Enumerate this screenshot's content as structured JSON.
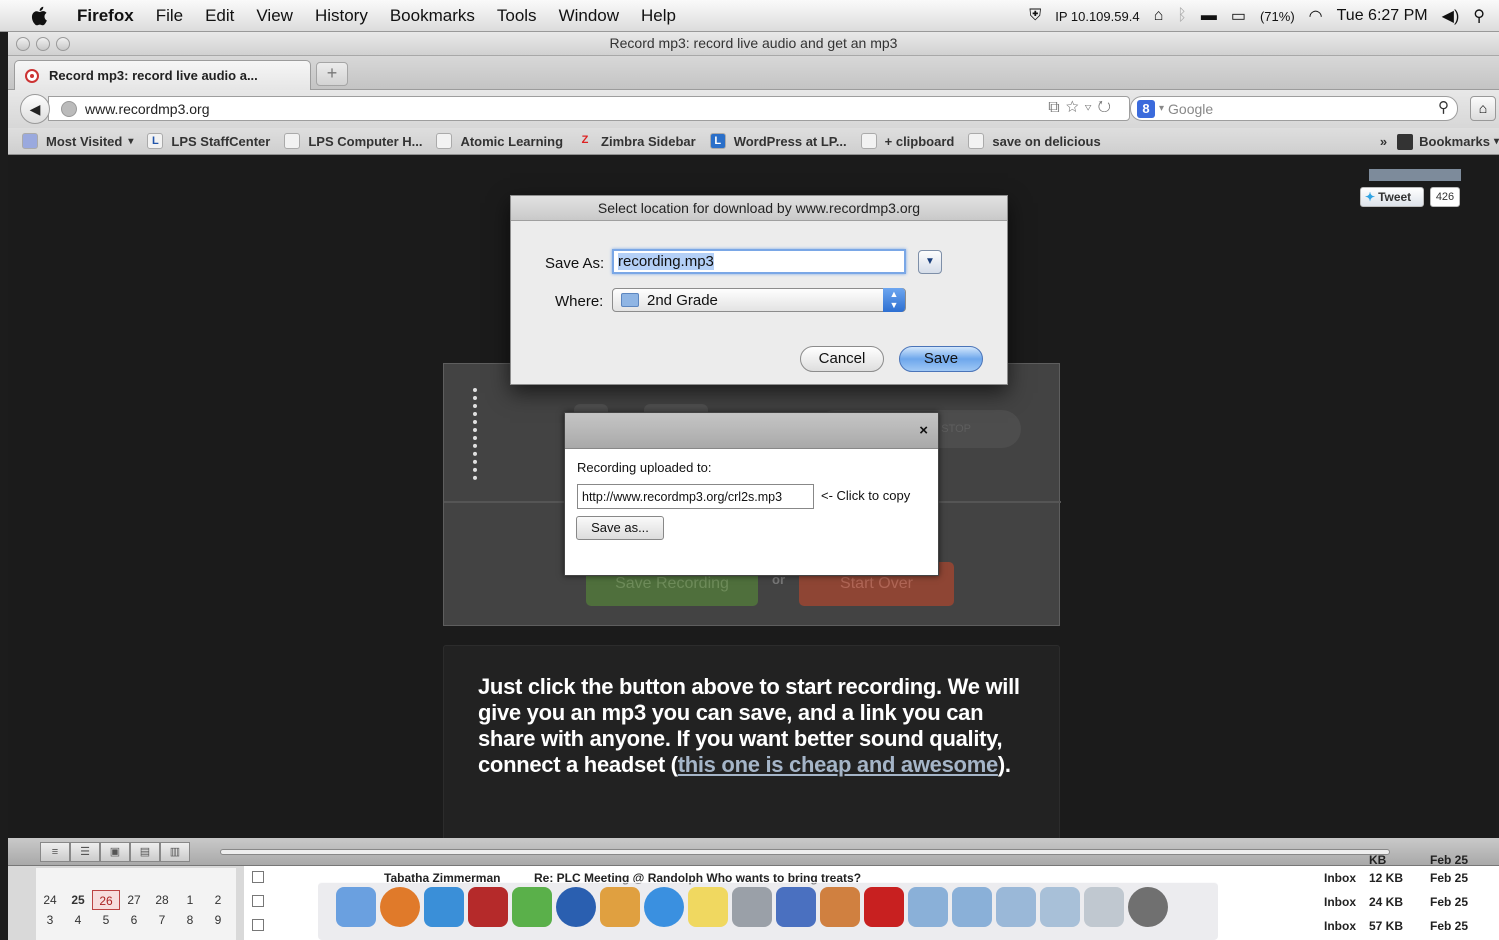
{
  "menubar": {
    "app_name": "Firefox",
    "items": [
      "File",
      "Edit",
      "View",
      "History",
      "Bookmarks",
      "Tools",
      "Window",
      "Help"
    ],
    "ip": "IP 10.109.59.4",
    "battery": "(71%)",
    "clock": "Tue 6:27 PM"
  },
  "window": {
    "title": "Record mp3: record live audio and get an mp3"
  },
  "tab": {
    "label": "Record mp3: record live audio a...",
    "new_tab": "+"
  },
  "navbar": {
    "url": "www.recordmp3.org",
    "search_placeholder": "Google"
  },
  "bookmarks": {
    "items": [
      "Most Visited",
      "LPS StaffCenter",
      "LPS Computer H...",
      "Atomic Learning",
      "Zimbra Sidebar",
      "WordPress at LP...",
      "+ clipboard",
      "save on delicious"
    ],
    "overflow": "»",
    "menu": "Bookmarks"
  },
  "tweet": {
    "label": "Tweet",
    "count": "426"
  },
  "recorder": {
    "save_recording": "Save Recording",
    "or": "or",
    "start_over": "Start Over",
    "stop": "STOP"
  },
  "info": {
    "text": "Just click the button above to start recording. We will give you an mp3 you can save, and a link you can share with anyone. If you want better sound quality, connect a headset (",
    "link": "this one is cheap and awesome",
    "after": ")."
  },
  "upload_popup": {
    "close": "×",
    "label": "Recording uploaded to:",
    "url": "http://www.recordmp3.org/crl2s.mp3",
    "copy_hint": "<- Click to copy",
    "save_as": "Save as..."
  },
  "save_dialog": {
    "title": "Select location for download by www.recordmp3.org",
    "save_as_label": "Save As:",
    "filename": "recording.mp3",
    "where_label": "Where:",
    "where_value": "2nd Grade",
    "cancel": "Cancel",
    "save": "Save"
  },
  "mail": {
    "calendar": [
      [
        "24",
        "25",
        "26",
        "27",
        "28",
        "1",
        "2"
      ],
      [
        "3",
        "4",
        "5",
        "6",
        "7",
        "8",
        "9"
      ]
    ],
    "today": "26",
    "rows": [
      {
        "sender": "Tabatha Zimmerman",
        "subject": "Re: PLC Meeting @ Randolph Who wants to bring treats?",
        "box": "Inbox",
        "size": "12 KB",
        "date": "Feb 25"
      },
      {
        "sender": "",
        "subject": "",
        "box": "Inbox",
        "size": "24 KB",
        "date": "Feb 25"
      },
      {
        "sender": "",
        "subject": "",
        "box": "Inbox",
        "size": "57 KB",
        "date": "Feb 25"
      }
    ],
    "top_size": "KB",
    "top_date": "Feb 25"
  }
}
